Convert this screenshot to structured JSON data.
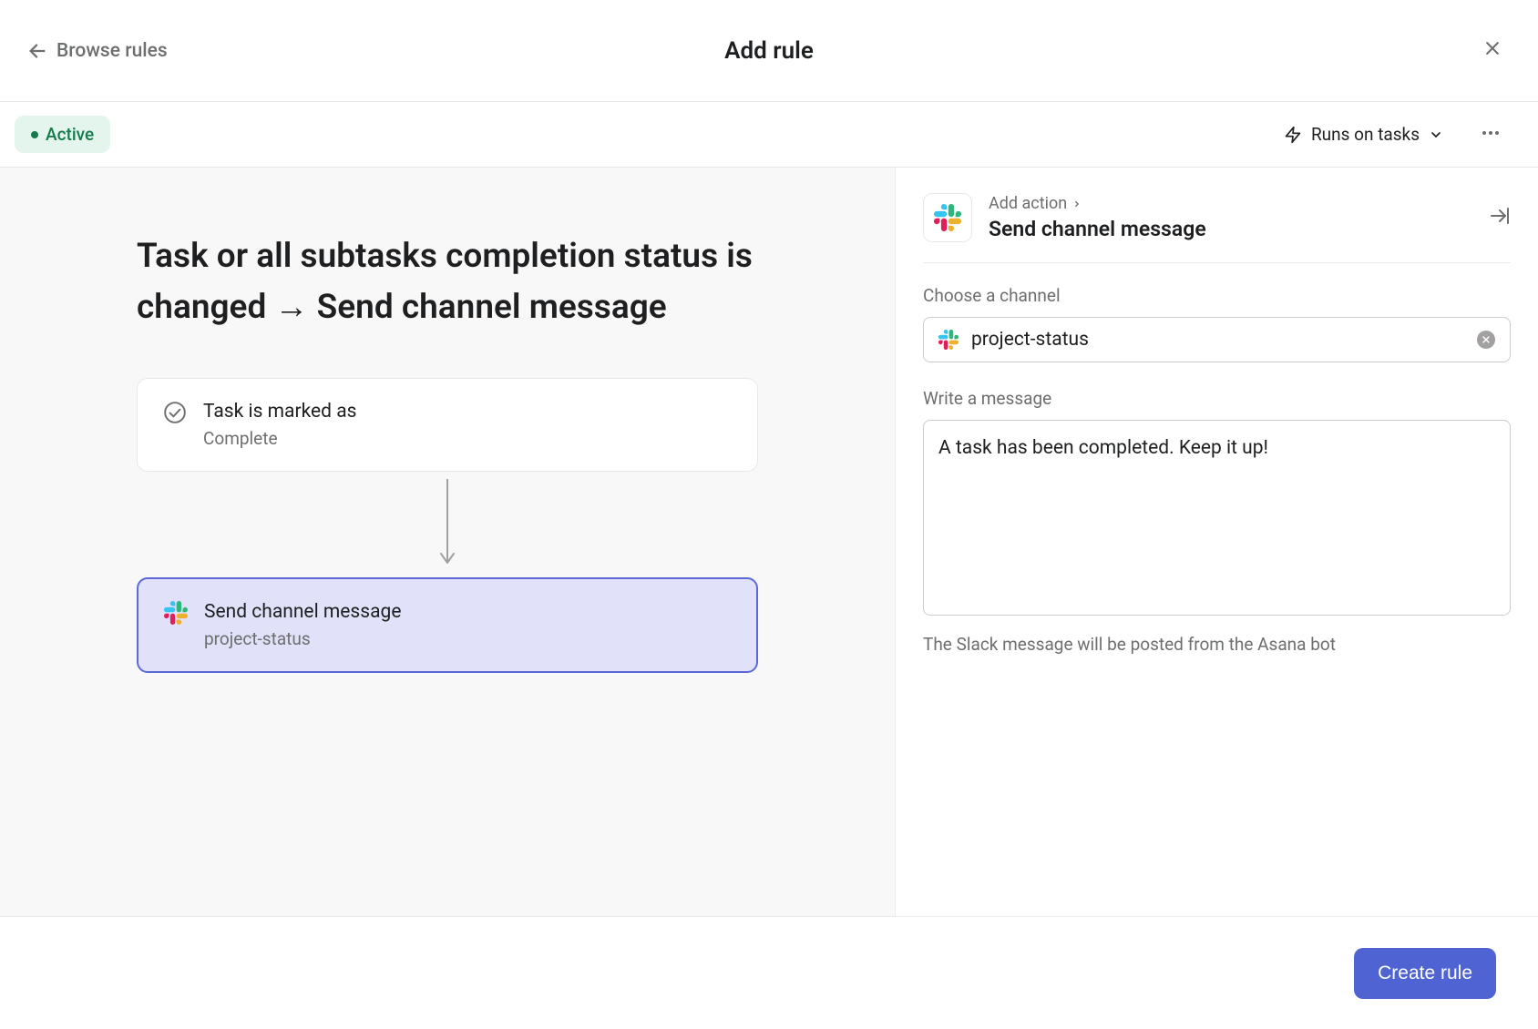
{
  "header": {
    "back_label": "Browse rules",
    "title": "Add rule"
  },
  "toolbar": {
    "status": "Active",
    "runs_on": "Runs on tasks"
  },
  "rule": {
    "title": "Task or all subtasks completion status is changed → Send channel message",
    "trigger": {
      "title": "Task is marked as",
      "subtitle": "Complete"
    },
    "action": {
      "title": "Send channel message",
      "subtitle": "project-status"
    }
  },
  "panel": {
    "breadcrumb": "Add action",
    "title": "Send channel message",
    "channel_label": "Choose a channel",
    "channel_value": "project-status",
    "message_label": "Write a message",
    "message_value": "A task has been completed. Keep it up!",
    "helper_text": "The Slack message will be posted from the Asana bot"
  },
  "footer": {
    "create_label": "Create rule"
  }
}
